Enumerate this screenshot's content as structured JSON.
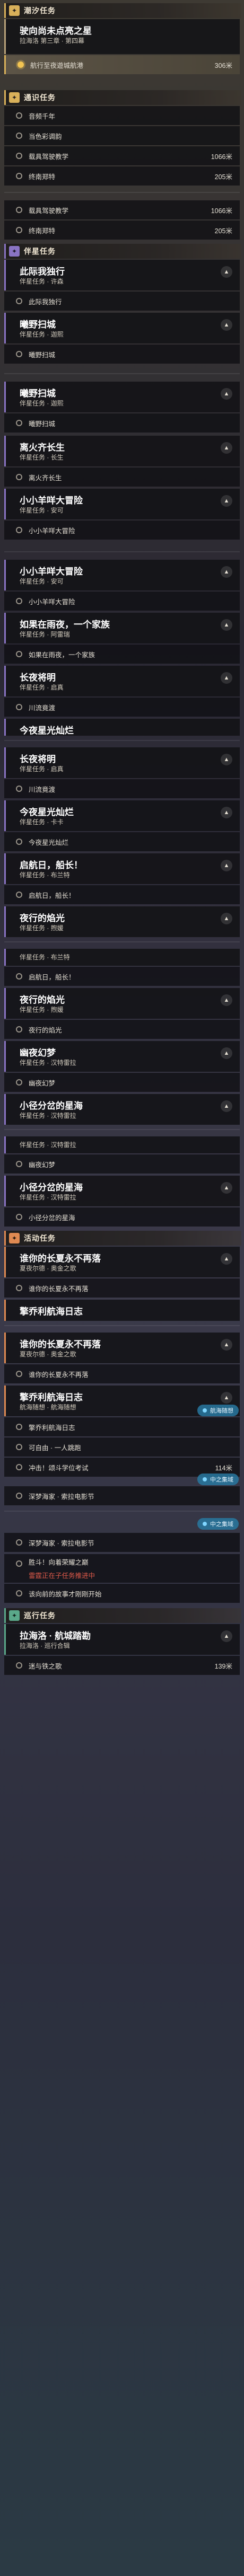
{
  "screens": [
    {
      "header": {
        "label": "潮汐任务",
        "badge": "✦"
      },
      "card": {
        "title": "驶向尚未点亮之星",
        "subtitle": "拉海洛 第三章 · 第四幕"
      },
      "active_step": {
        "text": "航行至夜遊城航港",
        "distance": "306米"
      }
    },
    {
      "header": {
        "label": "通识任务",
        "badge": "✦"
      },
      "steps": [
        {
          "text": "音频千年"
        },
        {
          "text": "当色彩调韵"
        },
        {
          "text": "载具驾驶教学",
          "distance": "1066米"
        },
        {
          "text": "终南郑特",
          "distance": "205米"
        }
      ]
    }
  ],
  "sections": {
    "tidal": "潮汐任务",
    "common": "通识任务",
    "companion": "伴星任务",
    "activity": "活动任务",
    "roaming": "巡行任务"
  },
  "tasks": {
    "t1": {
      "title": "此际我独行",
      "sub": "伴星任务 · 许森",
      "step": "此际我独行"
    },
    "t2": {
      "title": "曦野扫城",
      "sub": "伴星任务 · 迦熙",
      "step": "曦野扫城"
    },
    "t3": {
      "title": "离火齐长生",
      "sub": "伴星任务 · 长生",
      "step": "离火齐长生"
    },
    "t4": {
      "title": "小小羊咩大冒险",
      "sub": "伴星任务 · 安可",
      "step": "小小羊咩大冒险"
    },
    "t5": {
      "title": "如果在雨夜，一个家族",
      "sub": "伴星任务 · 阿雷瑞",
      "step": "如果在雨夜，一个家族"
    },
    "t6": {
      "title": "长夜将明",
      "sub": "伴星任务 · 启真",
      "step": "川流竟渡"
    },
    "t7": {
      "title": "今夜星光灿烂",
      "sub": "伴星任务 · 卡卡",
      "step": "今夜星光灿烂"
    },
    "t8": {
      "title": "启航日，船长！",
      "sub": "伴星任务 · 布兰特",
      "step": "启航日，船长！"
    },
    "t9": {
      "title": "夜行的焰光",
      "sub": "伴星任务 · 煦媛",
      "step": "夜行的焰光"
    },
    "t10": {
      "title": "幽夜幻梦",
      "sub": "伴星任务 · 汉特雷拉",
      "step": "幽夜幻梦"
    },
    "t11": {
      "title": "小径分岔的星海",
      "sub": "伴星任务 · 汉特雷拉",
      "step": "小径分岔的星海"
    },
    "t12": {
      "title": "谁你的长夏永不再落",
      "sub": "夏夜尔德 · 奥金之歌",
      "step": "谁你的长夏永不再落"
    },
    "t13": {
      "title": "擎乔利航海日志",
      "sub": "航海随想 · 航海随想",
      "step": "擎乔利航海日志"
    },
    "t14": {
      "title": "拉海洛 · 航城踏勘",
      "sub": "拉海洛 · 巡行合辑",
      "step": "迷与铁之歌"
    }
  },
  "activity_steps": {
    "s1": {
      "text": "可自由 · 一人跳跑"
    },
    "s2": {
      "text": "冲击！颂斗学位考试",
      "distance": "114米"
    },
    "s3": {
      "text": "深梦海家 · 索拉电影节"
    },
    "s4": {
      "text": "胜斗！向着荣耀之巅"
    },
    "s5": {
      "text": "雷霆正在子任务推进中"
    },
    "s6": {
      "text": "该向前的故事才刚刚开始"
    }
  },
  "floats": {
    "f1": "航海随想",
    "f2": "中之集域",
    "f3": "中之集域"
  },
  "bottom_distance": "139米"
}
